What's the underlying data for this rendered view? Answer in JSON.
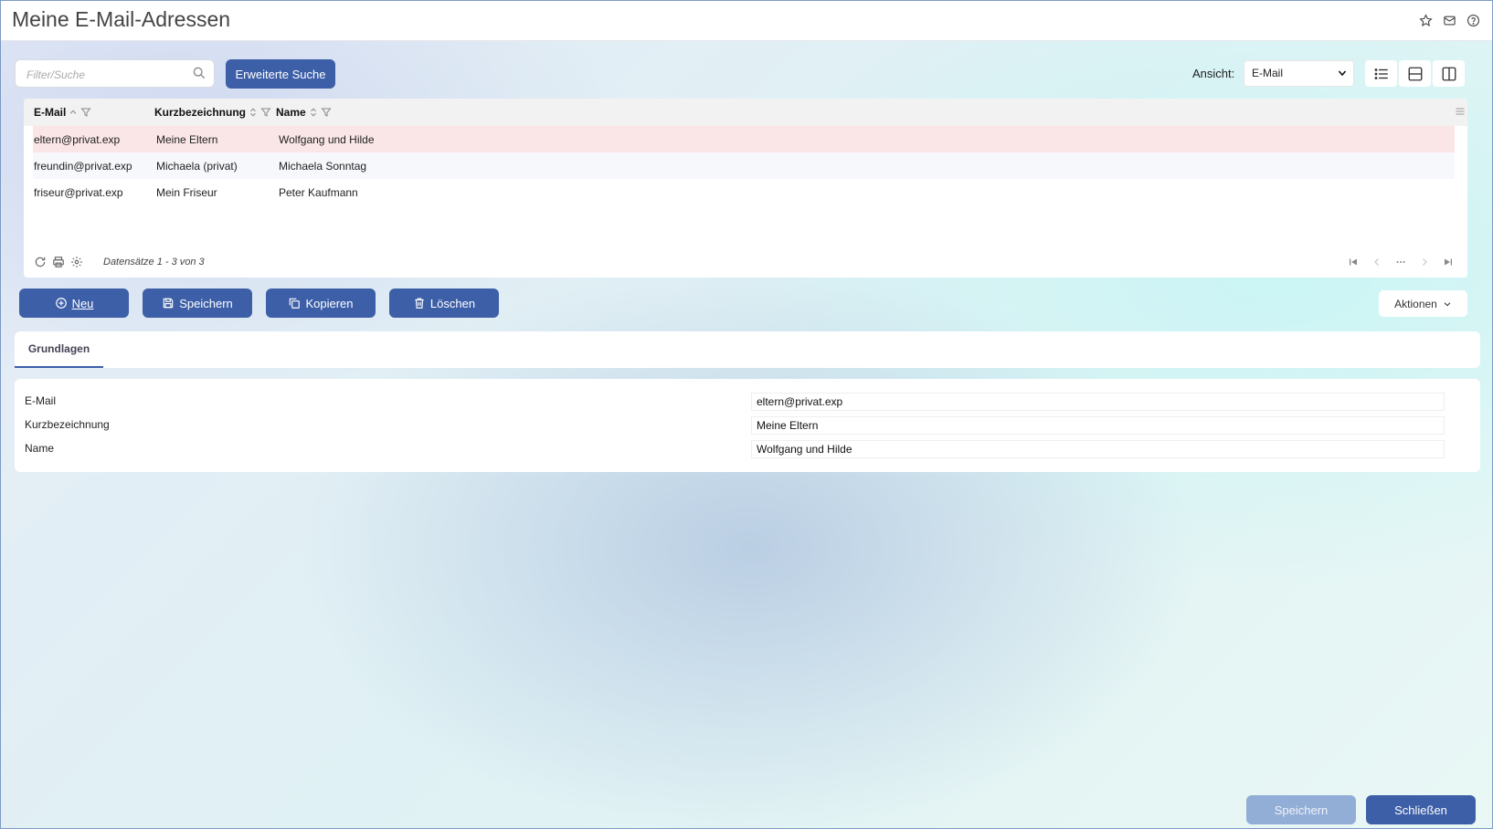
{
  "header": {
    "title": "Meine E-Mail-Adressen",
    "icons": [
      "star-icon",
      "mail-icon",
      "help-icon"
    ]
  },
  "toolbar": {
    "search_placeholder": "Filter/Suche",
    "search_value": "",
    "advanced_search_label": "Erweiterte Suche",
    "view_label": "Ansicht:",
    "view_selected": "E-Mail",
    "view_modes": [
      "list-view-icon",
      "split-horizontal-icon",
      "split-vertical-icon"
    ]
  },
  "grid": {
    "columns": [
      "E-Mail",
      "Kurzbezeichnung",
      "Name"
    ],
    "rows": [
      {
        "email": "eltern@privat.exp",
        "short": "Meine Eltern",
        "name": "Wolfgang und Hilde"
      },
      {
        "email": "freundin@privat.exp",
        "short": "Michaela (privat)",
        "name": "Michaela Sonntag"
      },
      {
        "email": "friseur@privat.exp",
        "short": "Mein Friseur",
        "name": "Peter Kaufmann"
      }
    ],
    "selected_row": 0,
    "records_text": "Datensätze 1 - 3 von 3"
  },
  "actions": {
    "new_label": "Neu",
    "save_label": "Speichern",
    "copy_label": "Kopieren",
    "delete_label": "Löschen",
    "more_label": "Aktionen"
  },
  "tabs": [
    {
      "label": "Grundlagen",
      "active": true
    }
  ],
  "form": {
    "fields": [
      {
        "label": "E-Mail",
        "value": "eltern@privat.exp"
      },
      {
        "label": "Kurzbezeichnung",
        "value": "Meine Eltern"
      },
      {
        "label": "Name",
        "value": "Wolfgang und Hilde"
      }
    ]
  },
  "footer": {
    "save_label": "Speichern",
    "close_label": "Schließen"
  },
  "colors": {
    "primary": "#3d5fa8",
    "selected_row": "#fae6e6",
    "disabled": "#93aed6"
  }
}
